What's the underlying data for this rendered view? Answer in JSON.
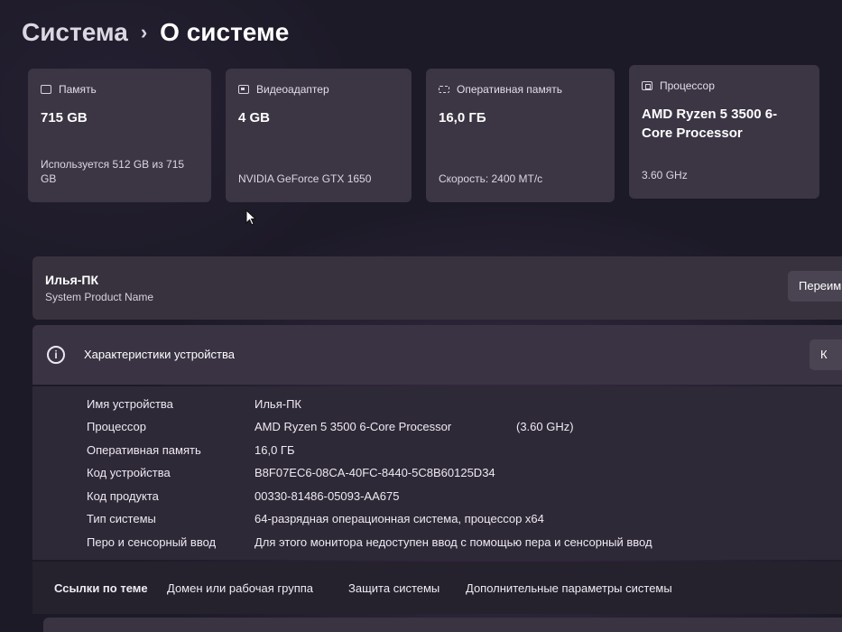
{
  "header": {
    "root": "Система",
    "separator": "›",
    "current": "О системе"
  },
  "cards": {
    "storage": {
      "label": "Память",
      "value": "715 GB",
      "sub": "Используется 512 GB из 715 GB"
    },
    "gpu": {
      "label": "Видеоадаптер",
      "value": "4 GB",
      "sub": "NVIDIA GeForce GTX 1650"
    },
    "ram": {
      "label": "Оперативная память",
      "value": "16,0 ГБ",
      "sub": "Скорость: 2400 МТ/с"
    },
    "cpu": {
      "label": "Процессор",
      "value": "AMD Ryzen 5 3500 6-Core Processor",
      "sub": "3.60 GHz"
    }
  },
  "device_name_row": {
    "name": "Илья-ПК",
    "sub": "System Product Name",
    "rename_button": "Переим"
  },
  "specs": {
    "title": "Характеристики устройства",
    "copy_button": "К",
    "rows": [
      {
        "label": "Имя устройства",
        "value": "Илья-ПК"
      },
      {
        "label": "Процессор",
        "value": "AMD Ryzen 5 3500 6-Core Processor",
        "extra": "(3.60 GHz)"
      },
      {
        "label": "Оперативная память",
        "value": "16,0 ГБ"
      },
      {
        "label": "Код устройства",
        "value": "B8F07EC6-08CA-40FC-8440-5C8B60125D34"
      },
      {
        "label": "Код продукта",
        "value": "00330-81486-05093-AA675"
      },
      {
        "label": "Тип системы",
        "value": "64-разрядная операционная система, процессор x64"
      },
      {
        "label": "Перо и сенсорный ввод",
        "value": "Для этого монитора недоступен ввод с помощью пера и сенсорный ввод"
      }
    ]
  },
  "links": {
    "title": "Ссылки по теме",
    "items": [
      "Домен или рабочая группа",
      "Защита системы",
      "Дополнительные параметры системы"
    ]
  }
}
